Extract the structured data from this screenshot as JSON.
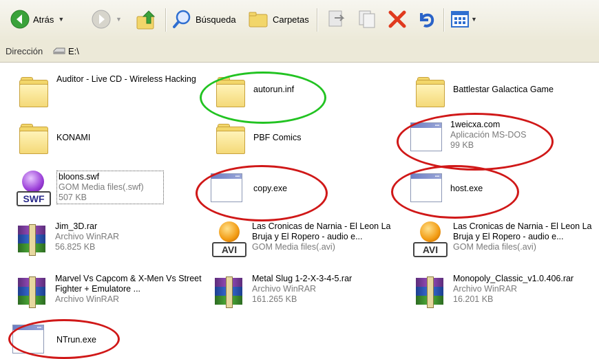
{
  "toolbar": {
    "back_label": "Atrás",
    "search_label": "Búsqueda",
    "folders_label": "Carpetas",
    "colors": {
      "back": "#3aa23a",
      "delete": "#e03a1e",
      "undo": "#2a63c8",
      "search": "#2f6fd0"
    }
  },
  "address": {
    "label": "Dirección",
    "path": "E:\\"
  },
  "files": {
    "auditor": {
      "name": "Auditor - Live CD - Wireless Hacking"
    },
    "autorun": {
      "name": "autorun.inf"
    },
    "battlestar": {
      "name": "Battlestar Galactica Game"
    },
    "konami": {
      "name": "KONAMI"
    },
    "pbf": {
      "name": "PBF Comics"
    },
    "weicxa": {
      "name": "1weicxa.com",
      "type": "Aplicación MS-DOS",
      "size": "99 KB"
    },
    "bloons": {
      "name": "bloons.swf",
      "type": "GOM Media files(.swf)",
      "size": "507 KB",
      "icon_tag": "SWF"
    },
    "copy": {
      "name": "copy.exe"
    },
    "host": {
      "name": "host.exe"
    },
    "jim": {
      "name": "Jim_3D.rar",
      "type": "Archivo WinRAR",
      "size": "56.825 KB"
    },
    "narnia1": {
      "name": "Las Cronicas de Narnia - El Leon La Bruja y El Ropero - audio e...",
      "type": "GOM Media files(.avi)",
      "icon_tag": "AVI"
    },
    "narnia2": {
      "name": "Las Cronicas de Narnia - El Leon La Bruja y El Ropero - audio e...",
      "type": "GOM Media files(.avi)",
      "icon_tag": "AVI"
    },
    "marvel": {
      "name": "Marvel Vs Capcom & X-Men Vs Street Fighter + Emulatore ...",
      "type": "Archivo WinRAR"
    },
    "metalslug": {
      "name": "Metal Slug 1-2-X-3-4-5.rar",
      "type": "Archivo WinRAR",
      "size": "161.265 KB"
    },
    "monopoly": {
      "name": "Monopoly_Classic_v1.0.406.rar",
      "type": "Archivo WinRAR",
      "size": "16.201 KB"
    },
    "ntrun": {
      "name": "NTrun.exe"
    }
  },
  "highlight_colors": {
    "suspicious": "#d01818",
    "ok": "#22c322"
  }
}
